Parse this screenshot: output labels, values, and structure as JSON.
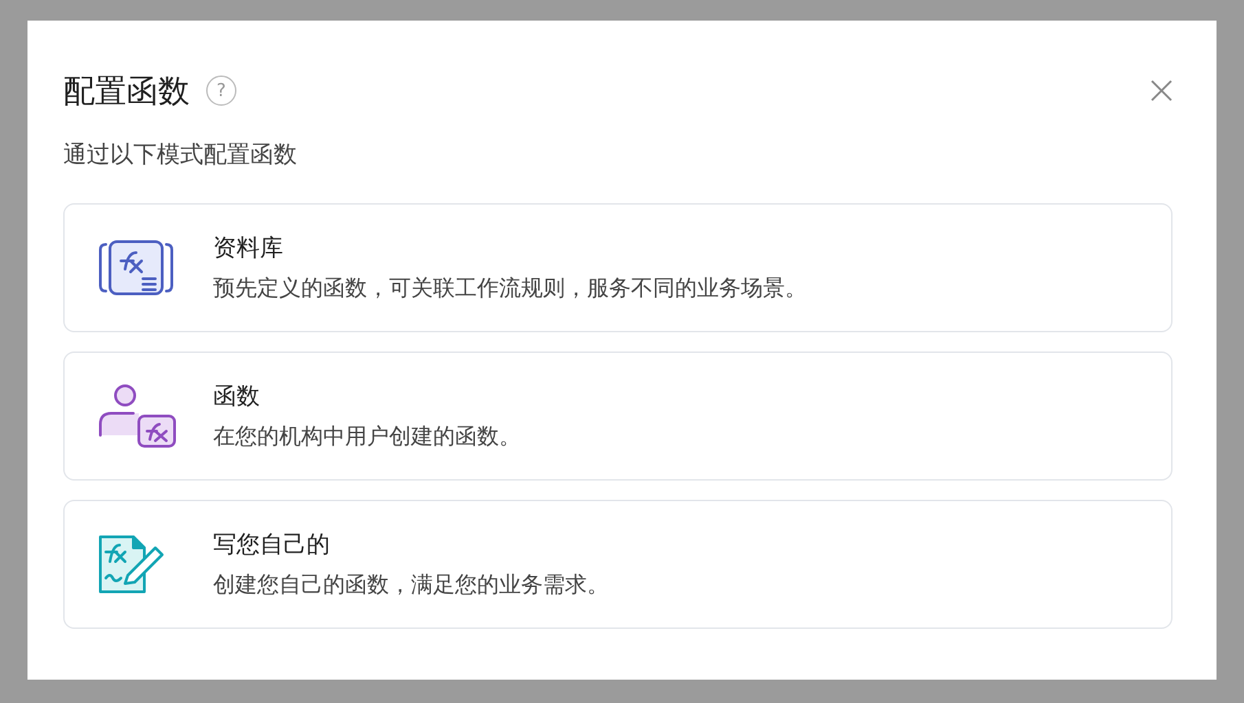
{
  "dialog": {
    "title": "配置函数",
    "help_icon": "?",
    "subtitle": "通过以下模式配置函数"
  },
  "options": [
    {
      "kind": "library",
      "title": "资料库",
      "description": "预先定义的函数，可关联工作流规则，服务不同的业务场景。"
    },
    {
      "kind": "function",
      "title": "函数",
      "description": "在您的机构中用户创建的函数。"
    },
    {
      "kind": "custom",
      "title": "写您自己的",
      "description": "创建您自己的函数，满足您的业务需求。"
    }
  ]
}
